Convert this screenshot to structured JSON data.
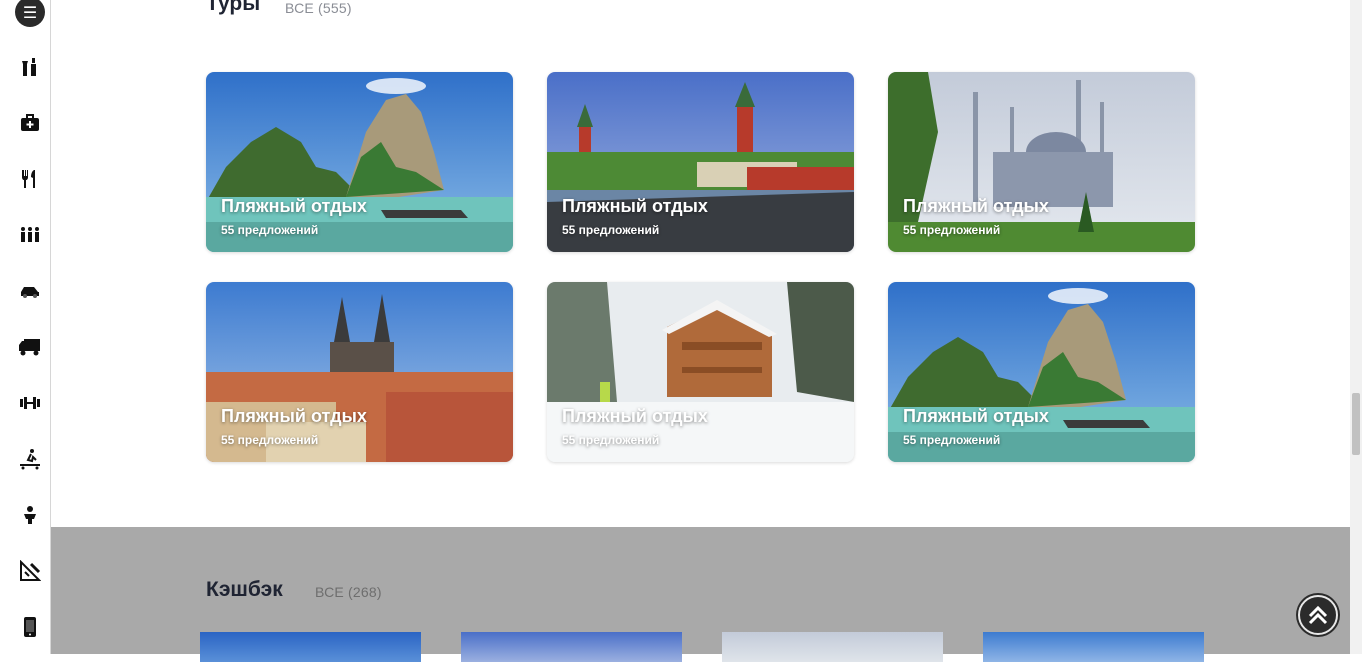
{
  "sidebar": {
    "icons": [
      {
        "name": "menu-icon",
        "glyph": "☰"
      },
      {
        "name": "bottles-icon",
        "glyph": "🍾"
      },
      {
        "name": "medical-kit-icon",
        "glyph": "✚"
      },
      {
        "name": "fork-knife-icon",
        "glyph": "🍴"
      },
      {
        "name": "people-icon",
        "glyph": "👪"
      },
      {
        "name": "car-icon",
        "glyph": "🚗"
      },
      {
        "name": "truck-icon",
        "glyph": "🚚"
      },
      {
        "name": "dumbbell-icon",
        "glyph": "🏋"
      },
      {
        "name": "cleaning-icon",
        "glyph": "🧹"
      },
      {
        "name": "child-icon",
        "glyph": "🚼"
      },
      {
        "name": "ruler-icon",
        "glyph": "📐"
      },
      {
        "name": "phone-icon",
        "glyph": "📱"
      }
    ]
  },
  "tours": {
    "title": "Туры",
    "all_link": "ВСЕ (555)",
    "cards": [
      {
        "title": "Пляжный отдых",
        "subtitle": "55 предложений",
        "scene": "beach"
      },
      {
        "title": "Пляжный отдых",
        "subtitle": "55 предложений",
        "scene": "kremlin"
      },
      {
        "title": "Пляжный отдых",
        "subtitle": "55 предложений",
        "scene": "mosque"
      },
      {
        "title": "Пляжный отдых",
        "subtitle": "55 предложений",
        "scene": "prague"
      },
      {
        "title": "Пляжный отдых",
        "subtitle": "55 предложений",
        "scene": "winter"
      },
      {
        "title": "Пляжный отдых",
        "subtitle": "55 предложений",
        "scene": "beach"
      }
    ]
  },
  "cashback": {
    "title": "Кэшбэк",
    "all_link": "ВСЕ (268)"
  }
}
